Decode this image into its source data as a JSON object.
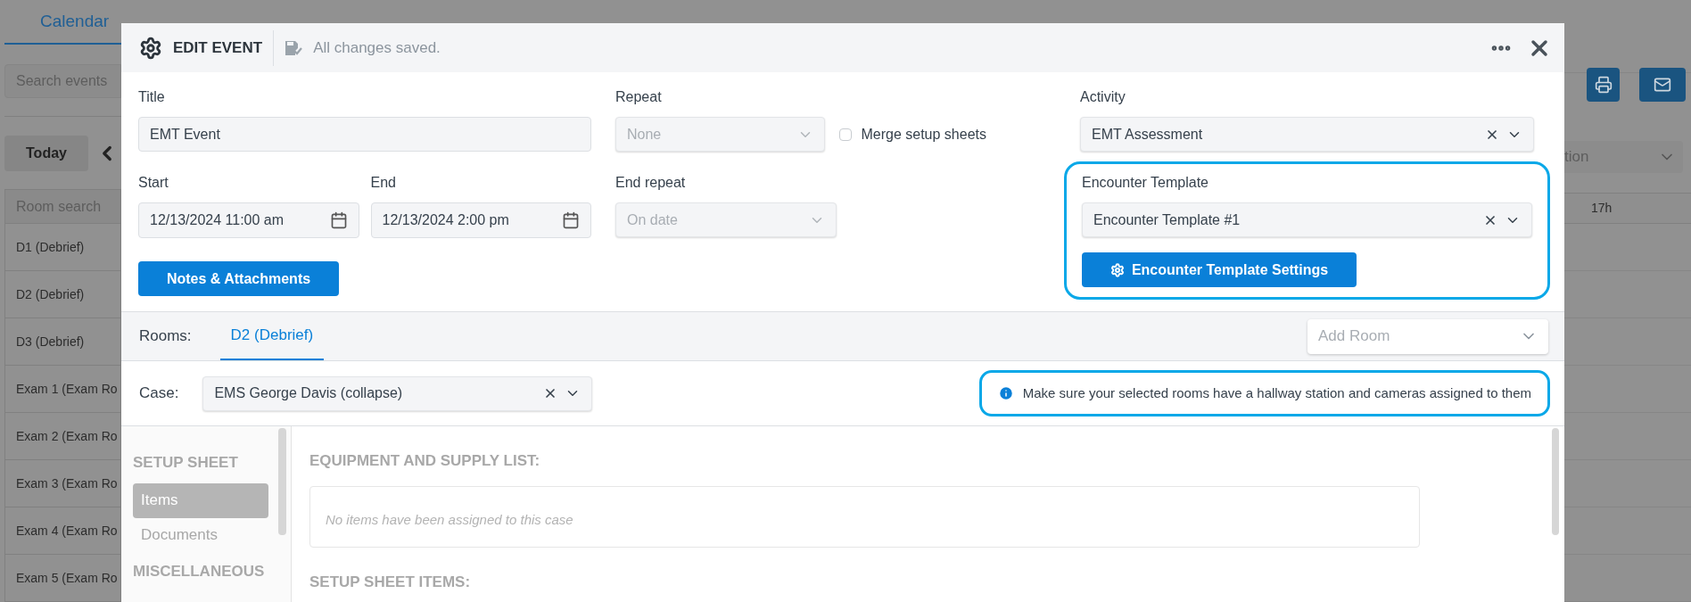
{
  "background": {
    "tab": "Calendar",
    "search_placeholder": "Search events",
    "today_button": "Today",
    "room_search_placeholder": "Room search",
    "rooms": [
      "D1 (Debrief)",
      "D2 (Debrief)",
      "D3 (Debrief)",
      "Exam 1 (Exam Ro",
      "Exam 2 (Exam Ro",
      "Exam 3 (Exam Ro",
      "Exam 4 (Exam Ro",
      "Exam 5 (Exam Ro"
    ],
    "view_select": "tion",
    "hour_column": "17h"
  },
  "dialog": {
    "title": "EDIT EVENT",
    "save_status": "All changes saved.",
    "title_field": {
      "label": "Title",
      "value": "EMT Event"
    },
    "repeat": {
      "label": "Repeat",
      "value": "None",
      "disabled": true
    },
    "merge_setup_sheets": {
      "label": "Merge setup sheets",
      "checked": false
    },
    "activity": {
      "label": "Activity",
      "value": "EMT Assessment"
    },
    "start": {
      "label": "Start",
      "value": "12/13/2024 11:00 am"
    },
    "end": {
      "label": "End",
      "value": "12/13/2024 2:00 pm"
    },
    "end_repeat": {
      "label": "End repeat",
      "value": "On date",
      "disabled": true
    },
    "notes_button": "Notes & Attachments",
    "encounter_template": {
      "label": "Encounter Template",
      "value": "Encounter Template #1",
      "button": "Encounter Template Settings",
      "highlighted": true
    },
    "rooms": {
      "label": "Rooms:",
      "tabs": [
        {
          "label": "D2 (Debrief)",
          "selected": true
        }
      ],
      "add_room_placeholder": "Add Room"
    },
    "case": {
      "label": "Case:",
      "value": "EMS George Davis (collapse)"
    },
    "notice": {
      "text": "Make sure your selected rooms have a hallway station and cameras assigned to them",
      "highlighted": true
    },
    "sidebar": [
      {
        "heading": "SETUP SHEET",
        "items": [
          {
            "label": "Items",
            "selected": true
          },
          {
            "label": "Documents",
            "selected": false
          }
        ]
      },
      {
        "heading": "MISCELLANEOUS"
      }
    ],
    "sections": [
      {
        "heading": "EQUIPMENT AND SUPPLY LIST:",
        "empty_message": "No items have been assigned to this case"
      },
      {
        "heading": "SETUP SHEET ITEMS:"
      }
    ]
  }
}
